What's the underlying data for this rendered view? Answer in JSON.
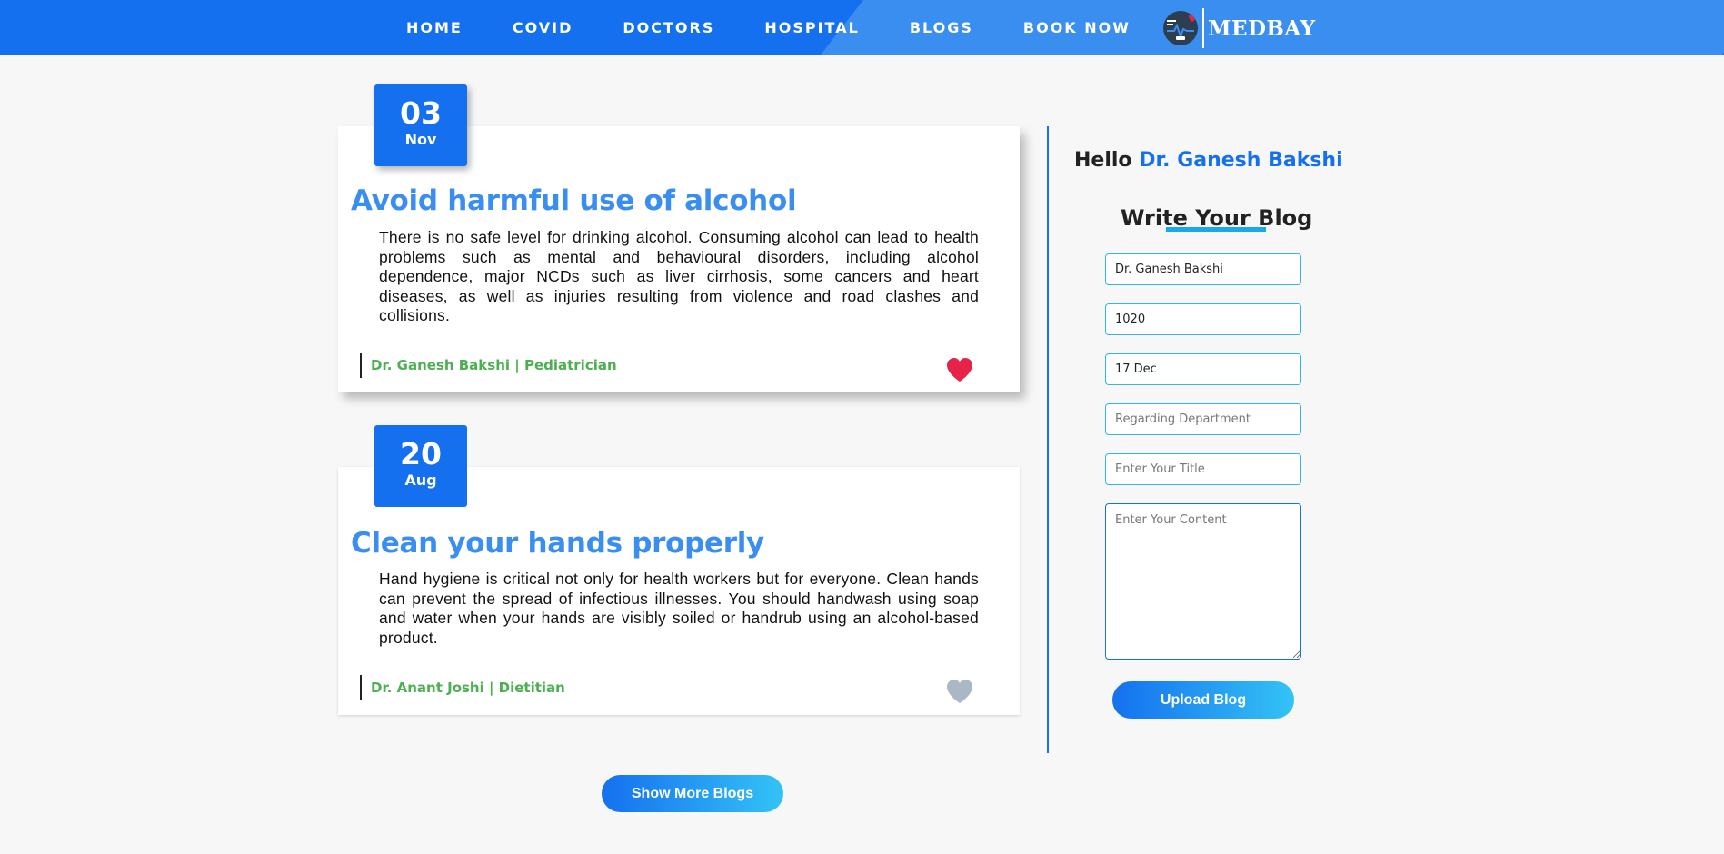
{
  "nav": {
    "links": [
      "HOME",
      "COVID",
      "DOCTORS",
      "HOSPITAL",
      "BLOGS",
      "BOOK NOW"
    ],
    "brand": "MEDBAY",
    "colors": {
      "primary": "#1570ef",
      "secondary": "#3a8ef0"
    }
  },
  "blogs": [
    {
      "day": "03",
      "month": "Nov",
      "title": "Avoid harmful use of alcohol",
      "body": "There is no safe level for drinking alcohol. Consuming alcohol can lead to health problems such as mental and behavioural disorders, including alcohol dependence, major NCDs such as liver cirrhosis, some cancers and heart diseases, as well as injuries resulting from violence and road clashes and collisions.",
      "author": "Dr. Ganesh Bakshi | Pediatrician",
      "liked": true,
      "heart_icon": "heart-icon",
      "heart_color": "#e8234a"
    },
    {
      "day": "20",
      "month": "Aug",
      "title": "Clean your hands properly",
      "body": "Hand hygiene is critical not only for health workers but for everyone. Clean hands can prevent the spread of infectious illnesses. You should handwash using soap and water when your hands are visibly soiled or handrub using an alcohol-based product.",
      "author": "Dr. Anant Joshi | Dietitian",
      "liked": false,
      "heart_icon": "heart-icon",
      "heart_color": "#a9b8c4"
    }
  ],
  "show_more_label": "Show More Blogs",
  "sidebar": {
    "hello_prefix": "Hello",
    "user_name": "Dr. Ganesh Bakshi",
    "write_title": "Write Your Blog",
    "form": {
      "name_value": "Dr. Ganesh Bakshi",
      "id_value": "1020",
      "date_value": "17 Dec",
      "department_placeholder": "Regarding Department",
      "title_placeholder": "Enter Your Title",
      "content_placeholder": "Enter Your Content"
    },
    "upload_label": "Upload Blog"
  }
}
